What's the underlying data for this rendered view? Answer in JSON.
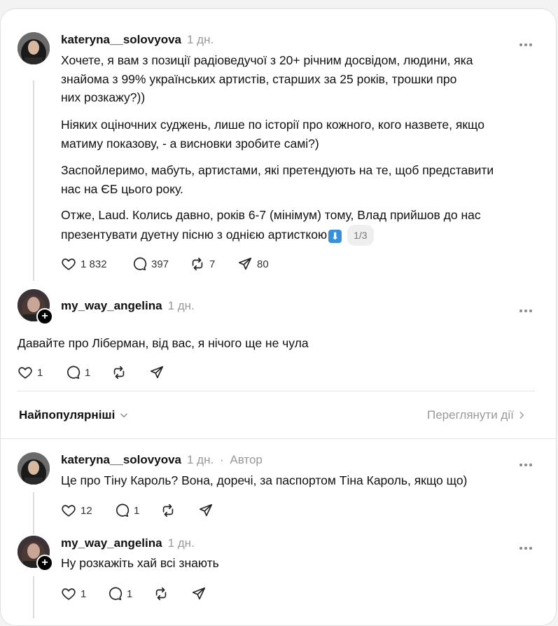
{
  "post": {
    "username": "kateryna__solovyova",
    "time": "1 дн.",
    "lines_p1": [
      "Хочете, я вам з позиції радіоведучої з 20+ річним досвідом, людини, яка",
      "знайома з 99% українських артистів, старших за 25 років, трошки про",
      "них розкажу?))"
    ],
    "lines_p2": [
      "Ніяких оціночних суджень, лише по історії про кожного, кого назвете, якщо",
      "матиму показову, - а висновки зробите самі?)"
    ],
    "lines_p3": [
      "Заспойлеримо, мабуть, артистами, які претендують на те, щоб представити",
      "нас на ЄБ цього року."
    ],
    "lines_p4": [
      "Отже, Laud. Колись давно, років 6-7 (мінімум) тому, Влад прийшов до нас",
      "презентувати дуетну пісню з однією артисткою"
    ],
    "emoji": "⬇",
    "pager": "1/3",
    "likes": "1 832",
    "comments": "397",
    "reposts": "7",
    "shares": "80"
  },
  "reply1": {
    "username": "my_way_angelina",
    "time": "1 дн.",
    "text": "Давайте про Ліберман, від вас, я нічого ще не чула",
    "likes": "1",
    "comments": "1"
  },
  "sort": {
    "label": "Найпопулярніші",
    "activity_link": "Переглянути дії"
  },
  "reply2": {
    "username": "kateryna__solovyova",
    "time": "1 дн.",
    "separator": "·",
    "author_tag": "Автор",
    "text": "Це про Тіну Кароль? Вона, доречі, за паспортом Тіна Кароль, якщо що)",
    "likes": "12",
    "comments": "1"
  },
  "reply3": {
    "username": "my_way_angelina",
    "time": "1 дн.",
    "text": "Ну розкажіть хай всі знають",
    "likes": "1",
    "comments": "1"
  },
  "icons": [
    "heart-icon",
    "comment-icon",
    "repost-icon",
    "share-icon",
    "more-icon",
    "follow-plus-icon",
    "chevron-down-icon",
    "chevron-right-icon",
    "arrow-down-emoji"
  ]
}
